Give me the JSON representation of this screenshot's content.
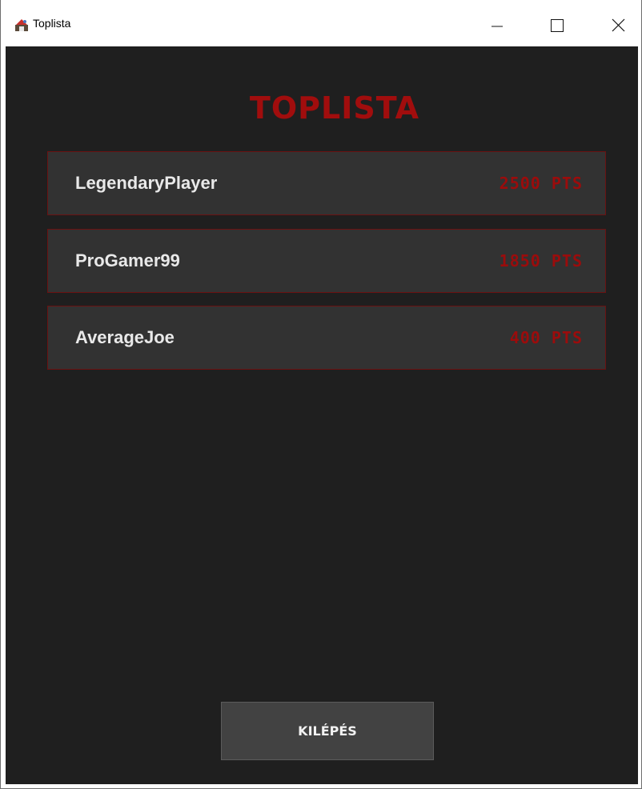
{
  "window": {
    "title": "Toplista",
    "controls": [
      "minimize",
      "maximize",
      "close"
    ]
  },
  "page": {
    "heading": "TOPLISTA",
    "heading_color": "#a10d0d",
    "background": "#1f1f1f"
  },
  "leaderboard": [
    {
      "name": "LegendaryPlayer",
      "score": "2500 PTS"
    },
    {
      "name": "ProGamer99",
      "score": "1850 PTS"
    },
    {
      "name": "AverageJoe",
      "score": "400 PTS"
    }
  ],
  "exit_button": {
    "label": "KILÉPÉS"
  },
  "icons": {
    "app": "java-app-icon",
    "minimize": "minimize-icon",
    "maximize": "maximize-icon",
    "close": "close-icon"
  }
}
